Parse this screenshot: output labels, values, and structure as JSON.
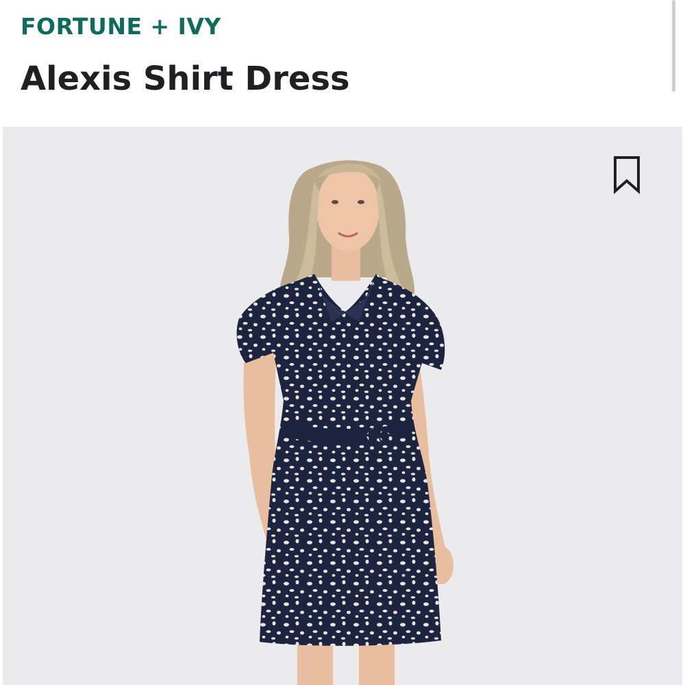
{
  "header": {
    "brand": "FORTUNE + IVY",
    "product_title": "Alexis Shirt Dress"
  },
  "product_image": {
    "icon": "bookmark-icon",
    "subject": "model-in-navy-leopard-print-shirt-dress"
  },
  "colors": {
    "brand": "#0f6b5c",
    "title": "#1f1f24",
    "image_background": "#ebebed",
    "dress": "#1d2440"
  }
}
